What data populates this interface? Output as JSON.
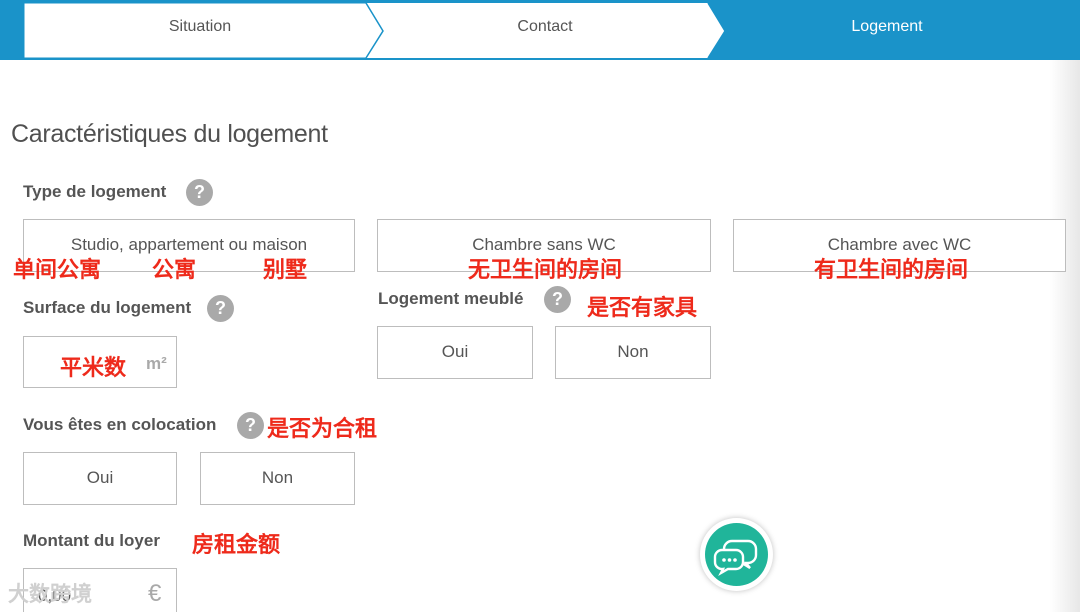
{
  "stepper": {
    "steps": [
      {
        "label": "Situation"
      },
      {
        "label": "Contact"
      },
      {
        "label": "Logement"
      }
    ]
  },
  "section": {
    "title": "Caractéristiques du logement"
  },
  "type_logement": {
    "label": "Type de logement",
    "help": "?",
    "options": [
      {
        "label": "Studio, appartement ou maison"
      },
      {
        "label": "Chambre sans WC"
      },
      {
        "label": "Chambre avec WC"
      }
    ],
    "annotations": [
      "单间公寓",
      "公寓",
      "别墅",
      "无卫生间的房间",
      "有卫生间的房间"
    ]
  },
  "surface": {
    "label": "Surface du logement",
    "help": "?",
    "unit": "m²",
    "annotation": "平米数"
  },
  "meuble": {
    "label": "Logement meublé",
    "help": "?",
    "annotation": "是否有家具",
    "yes": "Oui",
    "no": "Non"
  },
  "colocation": {
    "label": "Vous êtes en colocation",
    "help": "?",
    "annotation": "是否为合租",
    "yes": "Oui",
    "no": "Non"
  },
  "loyer": {
    "label": "Montant du loyer",
    "annotation": "房租金额",
    "value": "0,00",
    "unit": "€"
  },
  "chat": {
    "icon": "chat-bubbles-icon",
    "color": "#20b59a"
  },
  "watermark": "大数跨境",
  "colors": {
    "accent": "#1a93c9",
    "annotation": "#ee2a1b"
  }
}
